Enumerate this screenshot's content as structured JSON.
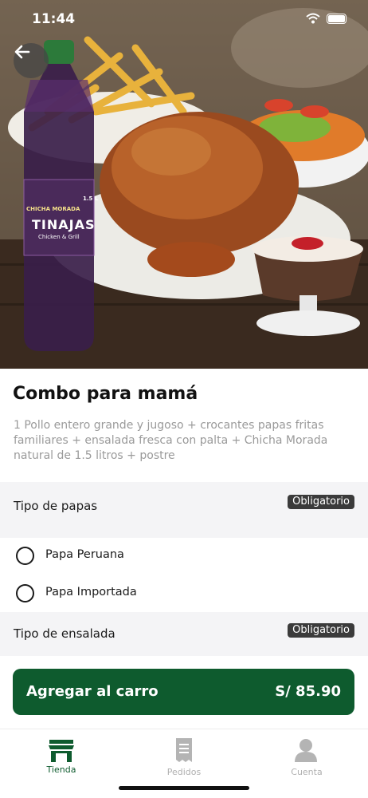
{
  "status_bar": {
    "time": "11:44"
  },
  "product": {
    "title": "Combo para mamá",
    "description": "1 Pollo entero grande y jugoso + crocantes papas fritas familiares + ensalada fresca con palta + Chicha Morada natural de 1.5 litros + postre",
    "bottle_brand": "TINAJAS",
    "bottle_sub": "Chicken & Grill",
    "bottle_tag": "CHICHA MORADA",
    "bottle_size": "1.5 L"
  },
  "sections": [
    {
      "label": "Tipo de papas",
      "badge": "Obligatorio",
      "options": [
        "Papa Peruana",
        "Papa Importada"
      ]
    },
    {
      "label": "Tipo de ensalada",
      "badge": "Obligatorio"
    }
  ],
  "cart_button": {
    "label": "Agregar al carro",
    "price": "S/ 85.90"
  },
  "tabs": [
    {
      "label": "Tienda",
      "icon": "store-icon",
      "active": true
    },
    {
      "label": "Pedidos",
      "icon": "receipt-icon",
      "active": false
    },
    {
      "label": "Cuenta",
      "icon": "user-icon",
      "active": false
    }
  ],
  "colors": {
    "primary": "#0e5b2e",
    "badge": "#3b3b3b",
    "section_bg": "#f4f4f6"
  }
}
